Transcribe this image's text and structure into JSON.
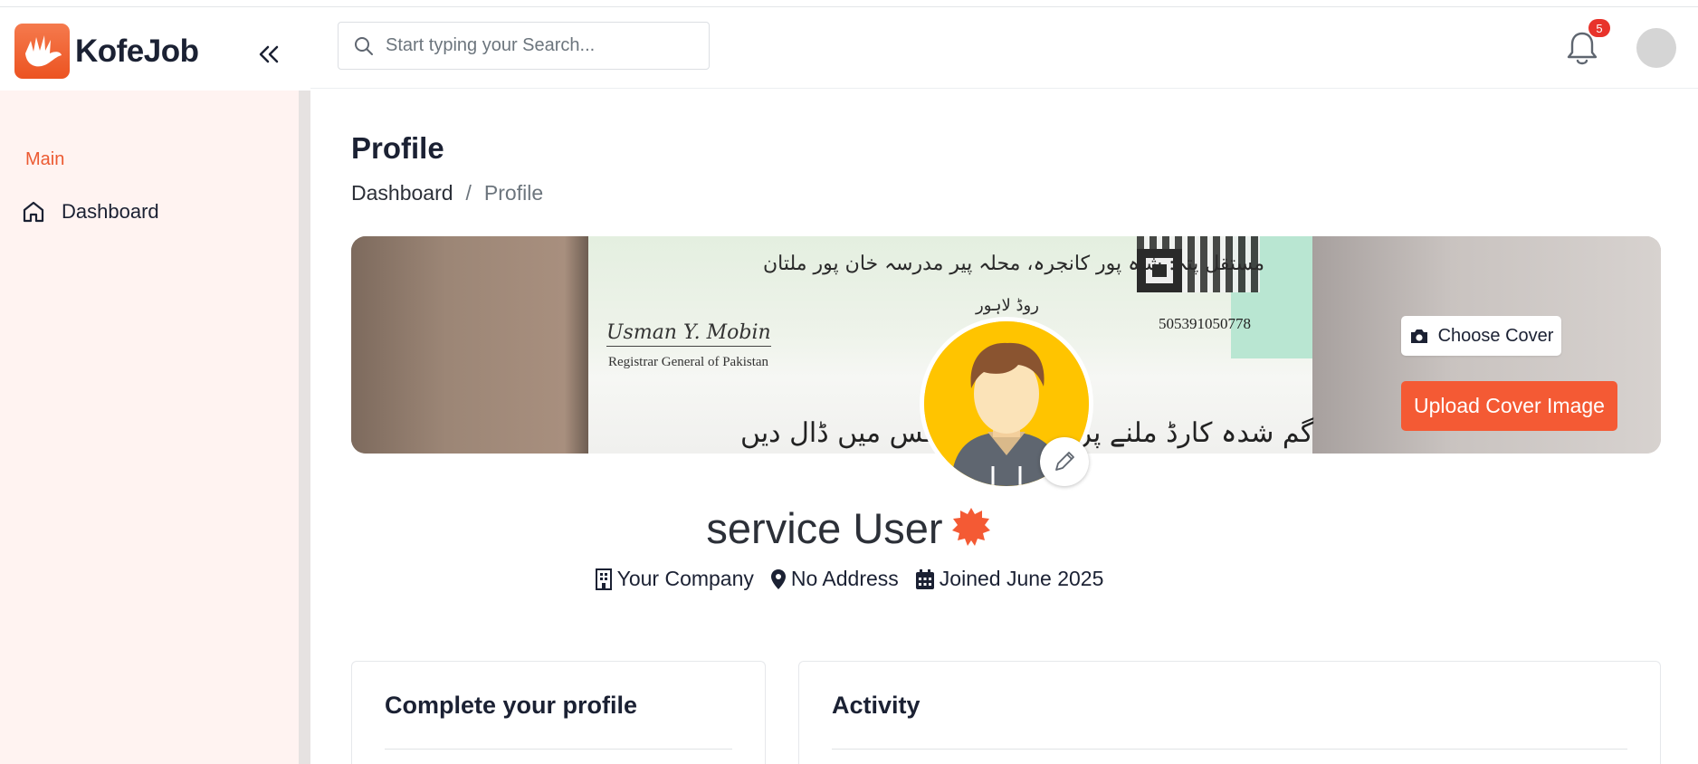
{
  "brand": {
    "name": "KofeJob",
    "logo_icon": "hand-logo-icon"
  },
  "sidebar": {
    "section_label": "Main",
    "items": [
      {
        "label": "Dashboard",
        "icon": "home-icon"
      }
    ]
  },
  "header": {
    "search_placeholder": "Start typing your Search...",
    "notification_count": "5"
  },
  "page": {
    "title": "Profile",
    "breadcrumb": {
      "parent": "Dashboard",
      "separator": "/",
      "current": "Profile"
    }
  },
  "cover": {
    "image_text": {
      "urdu_line1": "مستقل پتہ: شاہ پور کانجرہ، محلہ پیر مدرسہ خان پور ملتان",
      "urdu_line2": "روڈ لاہور",
      "signature": "Usman Y. Mobin",
      "registrar": "Registrar General of Pakistan",
      "number": "505391050778",
      "urdu_line3": "گم شدہ کارڈ ملنے پر قریبی لیٹر بکس میں ڈال دیں"
    },
    "choose_label": "Choose Cover",
    "upload_label": "Upload Cover Image"
  },
  "profile": {
    "name": "service User",
    "company": "Your Company",
    "address": "No Address",
    "joined": "Joined June 2025"
  },
  "cards": {
    "complete_title": "Complete your profile",
    "activity_title": "Activity"
  },
  "colors": {
    "accent": "#f45a34",
    "sidebar_bg": "#fff3f1",
    "badge": "#e8332b",
    "avatar_bg": "#ffc400"
  }
}
